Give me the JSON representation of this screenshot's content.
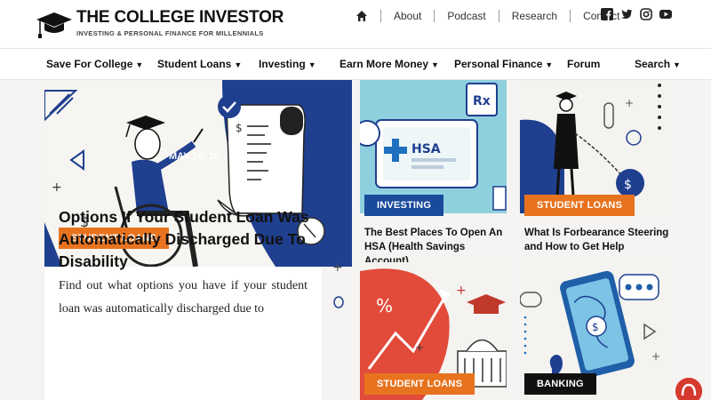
{
  "brand": {
    "title": "THE COLLEGE INVESTOR",
    "tagline": "INVESTING & PERSONAL FINANCE FOR MILLENNIALS",
    "accent": "#e8731f",
    "navy": "#1a3a8a"
  },
  "topnav": {
    "home_icon": "home-icon",
    "links": [
      "About",
      "Podcast",
      "Research",
      "Contact"
    ]
  },
  "social": [
    "facebook-icon",
    "twitter-icon",
    "instagram-icon",
    "youtube-icon"
  ],
  "mainnav": {
    "items": [
      {
        "label": "Save For College",
        "has_dropdown": true
      },
      {
        "label": "Student Loans",
        "has_dropdown": true
      },
      {
        "label": "Investing",
        "has_dropdown": true
      },
      {
        "label": "Earn More Money",
        "has_dropdown": true
      },
      {
        "label": "Personal Finance",
        "has_dropdown": true
      },
      {
        "label": "Forum",
        "has_dropdown": false
      },
      {
        "label": "Search",
        "has_dropdown": true
      }
    ]
  },
  "featured": {
    "category": "STUDENT LOANS",
    "date": "MAY 16, 20",
    "title": "Options If Your Student Loan Was Automatically Discharged Due To Disability",
    "excerpt": "Find out what options you have if your student loan was automatically discharged due to"
  },
  "cards": [
    {
      "category": "INVESTING",
      "category_color": "#1a4a9c",
      "title": "The Best Places To Open An HSA (Health Savings Account)"
    },
    {
      "category": "STUDENT LOANS",
      "category_color": "#e8731f",
      "title": "What Is Forbearance Steering and How to Get Help"
    },
    {
      "category": "STUDENT LOANS",
      "category_color": "#e8731f",
      "title": ""
    },
    {
      "category": "BANKING",
      "category_color": "#111111",
      "title": ""
    }
  ],
  "hsa_label": "HSA",
  "rx_label": "Rx"
}
